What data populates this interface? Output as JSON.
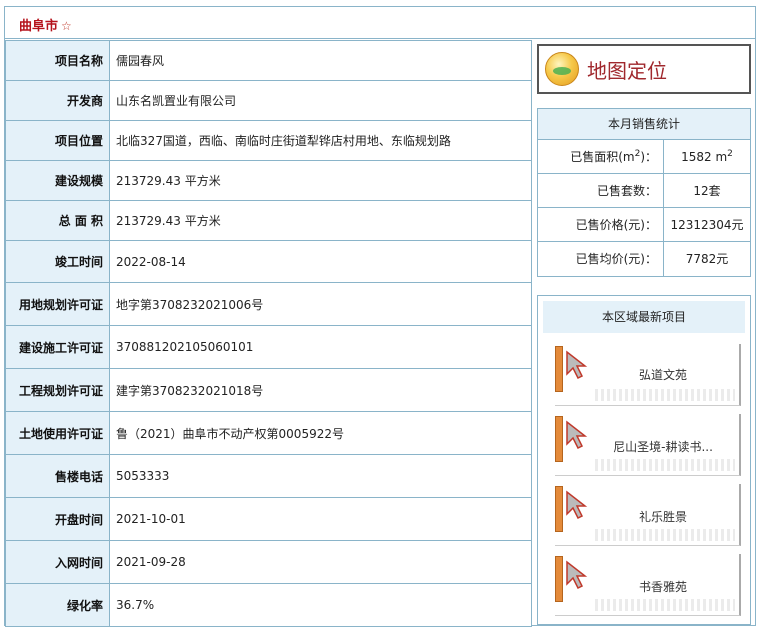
{
  "header": {
    "city": "曲阜市",
    "star": "☆"
  },
  "info_rows": [
    {
      "label": "项目名称",
      "value": "儒园春风"
    },
    {
      "label": "开发商",
      "value": "山东名凯置业有限公司"
    },
    {
      "label": "项目位置",
      "value": "北临327国道，西临、南临时庄街道犁铧店村用地、东临规划路"
    },
    {
      "label": "建设规模",
      "value": "213729.43 平方米"
    },
    {
      "label": "总 面 积",
      "value": "213729.43 平方米"
    },
    {
      "label": "竣工时间",
      "value": "2022-08-14"
    },
    {
      "label": "用地规划许可证",
      "value": "地字第3708232021006号"
    },
    {
      "label": "建设施工许可证",
      "value": "370881202105060101"
    },
    {
      "label": "工程规划许可证",
      "value": "建字第3708232021018号"
    },
    {
      "label": "土地使用许可证",
      "value": "鲁（2021）曲阜市不动产权第0005922号"
    },
    {
      "label": "售楼电话",
      "value": "5053333"
    },
    {
      "label": "开盘时间",
      "value": "2021-10-01"
    },
    {
      "label": "入网时间",
      "value": "2021-09-28"
    },
    {
      "label": "绿化率",
      "value": "36.7%"
    }
  ],
  "map_button": {
    "label": "地图定位",
    "icon": "map-locate-icon"
  },
  "sales": {
    "title": "本月销售统计",
    "area_label": "已售面积(m",
    "area_label_sup": "2",
    "area_label_end": ")：",
    "area_value": "1582 m",
    "area_value_sup": "2",
    "units_label": "已售套数：",
    "units_value": "12套",
    "price_label": "已售价格(元)：",
    "price_value": "12312304元",
    "avg_label": "已售均价(元)：",
    "avg_value": "7782元"
  },
  "region": {
    "title": "本区域最新项目",
    "projects": [
      "弘道文苑",
      "尼山圣境-耕读书...",
      "礼乐胜景",
      "书香雅苑"
    ]
  }
}
